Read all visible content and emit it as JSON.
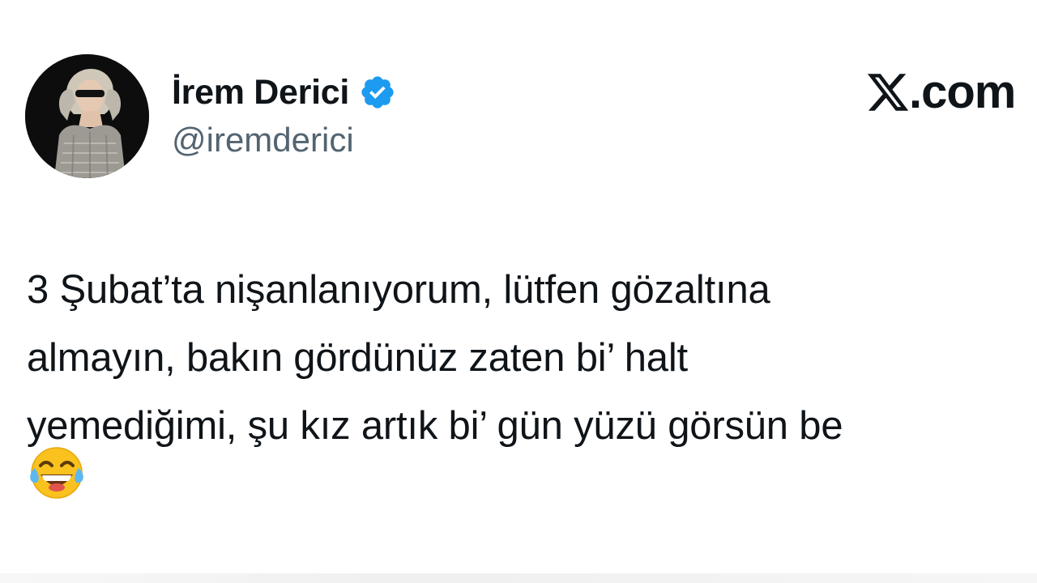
{
  "author": {
    "display_name": "İrem Derici",
    "handle": "@iremderici",
    "verified": true
  },
  "brand": {
    "icon": "x-logo-icon",
    "text": ".com"
  },
  "tweet": {
    "lines": [
      "3 Şubat’ta nişanlanıyorum, lütfen gözaltına",
      "almayın, bakın gördünüz zaten bi’ halt",
      "yemediğimi, şu kız artık bi’ gün yüzü görsün be"
    ],
    "emoji": "face-with-tears-of-joy-icon"
  },
  "colors": {
    "text": "#0f1419",
    "handle": "#536471",
    "verified": "#1d9bf0",
    "background": "#ffffff"
  }
}
